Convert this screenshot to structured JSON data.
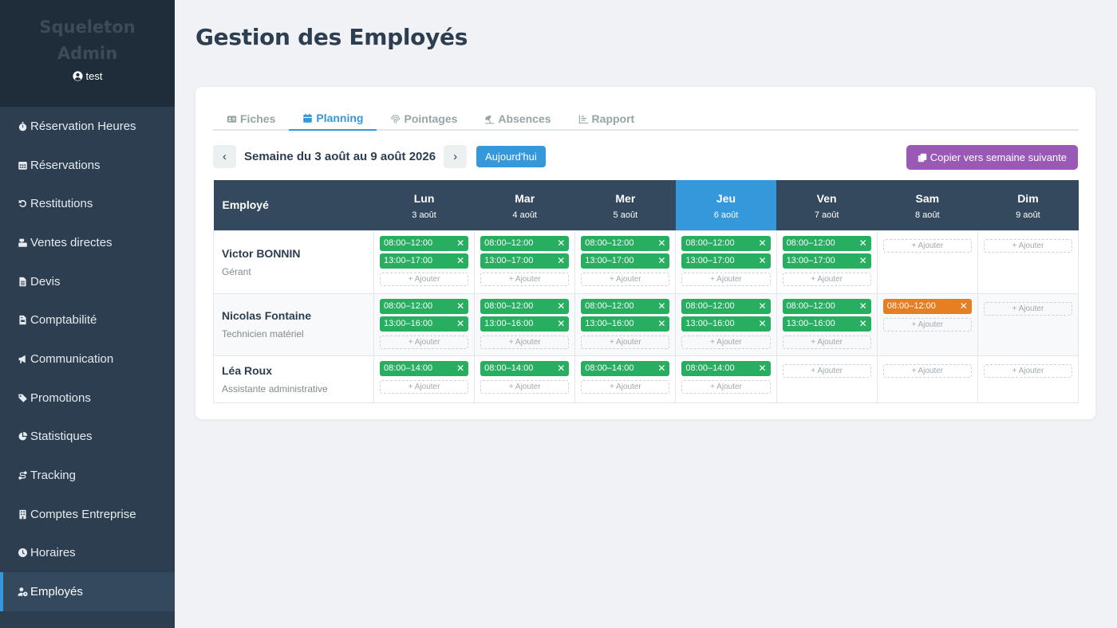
{
  "brand": {
    "name": "Squeleton Admin",
    "user": "test"
  },
  "sidebar": {
    "items": [
      {
        "label": "Réservation Heures",
        "icon": "stopwatch-icon"
      },
      {
        "label": "Réservations",
        "icon": "calendar-grid-icon"
      },
      {
        "label": "Restitutions",
        "icon": "undo-icon"
      },
      {
        "label": "Ventes directes",
        "icon": "cash-register-icon"
      },
      {
        "label": "Devis",
        "icon": "file-icon"
      },
      {
        "label": "Comptabilité",
        "icon": "file-invoice-icon"
      },
      {
        "label": "Communication",
        "icon": "bullhorn-icon"
      },
      {
        "label": "Promotions",
        "icon": "tags-icon"
      },
      {
        "label": "Statistiques",
        "icon": "pie-chart-icon"
      },
      {
        "label": "Tracking",
        "icon": "route-icon"
      },
      {
        "label": "Comptes Entreprise",
        "icon": "building-icon"
      },
      {
        "label": "Horaires",
        "icon": "clock-icon"
      },
      {
        "label": "Employés",
        "icon": "user-clock-icon",
        "active": true
      }
    ]
  },
  "page": {
    "title": "Gestion des Employés"
  },
  "tabs": [
    {
      "label": "Fiches",
      "icon": "id-card-icon"
    },
    {
      "label": "Planning",
      "icon": "calendar-icon",
      "active": true
    },
    {
      "label": "Pointages",
      "icon": "fingerprint-icon"
    },
    {
      "label": "Absences",
      "icon": "umbrella-beach-icon"
    },
    {
      "label": "Rapport",
      "icon": "chart-icon"
    }
  ],
  "week": {
    "prev": "‹",
    "next": "›",
    "label": "Semaine du 3 août au 9 août 2026",
    "today_button": "Aujourd'hui",
    "copy_button": "Copier vers semaine suivante"
  },
  "table": {
    "employee_header": "Employé",
    "add_label": "+ Ajouter",
    "days": [
      {
        "name": "Lun",
        "date": "3 août"
      },
      {
        "name": "Mar",
        "date": "4 août"
      },
      {
        "name": "Mer",
        "date": "5 août"
      },
      {
        "name": "Jeu",
        "date": "6 août",
        "today": true
      },
      {
        "name": "Ven",
        "date": "7 août"
      },
      {
        "name": "Sam",
        "date": "8 août"
      },
      {
        "name": "Dim",
        "date": "9 août"
      }
    ],
    "employees": [
      {
        "name": "Victor BONNIN",
        "role": "Gérant",
        "slots": [
          [
            "08:00–12:00",
            "13:00–17:00"
          ],
          [
            "08:00–12:00",
            "13:00–17:00"
          ],
          [
            "08:00–12:00",
            "13:00–17:00"
          ],
          [
            "08:00–12:00",
            "13:00–17:00"
          ],
          [
            "08:00–12:00",
            "13:00–17:00"
          ],
          [],
          []
        ]
      },
      {
        "name": "Nicolas Fontaine",
        "role": "Technicien matériel",
        "slots": [
          [
            "08:00–12:00",
            "13:00–16:00"
          ],
          [
            "08:00–12:00",
            "13:00–16:00"
          ],
          [
            "08:00–12:00",
            "13:00–16:00"
          ],
          [
            "08:00–12:00",
            "13:00–16:00"
          ],
          [
            "08:00–12:00",
            "13:00–16:00"
          ],
          [
            "08:00–12:00"
          ],
          []
        ]
      },
      {
        "name": "Léa Roux",
        "role": "Assistante administrative",
        "slots": [
          [
            "08:00–14:00"
          ],
          [
            "08:00–14:00"
          ],
          [
            "08:00–14:00"
          ],
          [
            "08:00–14:00"
          ],
          [],
          [],
          []
        ]
      }
    ]
  },
  "colors": {
    "sidebar": "#2c3e50",
    "accent": "#3498db",
    "slot": "#27ae60",
    "slot_weekend": "#e67e22",
    "copy_button": "#9b59b6"
  }
}
